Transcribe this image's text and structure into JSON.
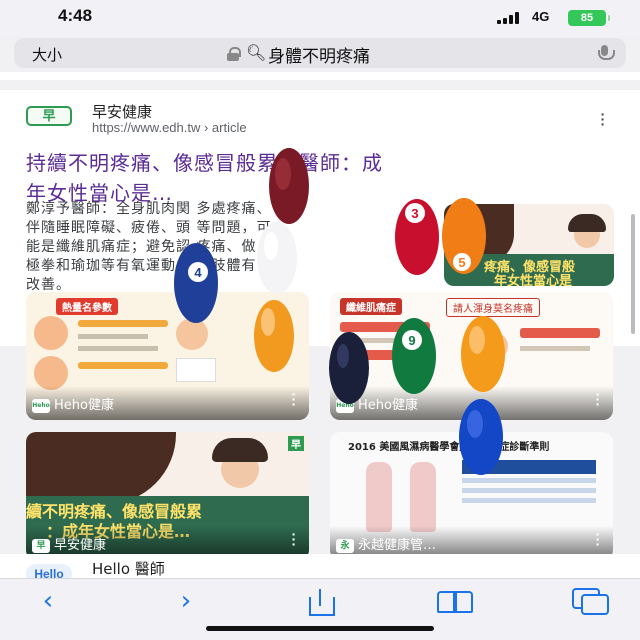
{
  "status_bar": {
    "time": "4:48",
    "network": "4G",
    "battery": "85"
  },
  "address_bar": {
    "text_size_label": "大小",
    "query": "身體不明疼痛"
  },
  "result": {
    "site_name": "早安健康",
    "site_url": "https://www.edh.tw › article",
    "title_line1": "持續不明疼痛、像感冒般累！醫師：成",
    "title_line2": "年女性當心是…",
    "snippet_lines": [
      "鄭淳予醫師：全身肌肉関 多處疼痛、",
      "伴隨睡眠障礙、疲倦、頭 等問題，可",
      "能是纖維肌痛症；避免認 疼痛、做",
      "極拳和瑜珈等有氧運動 伸展肢體有",
      "改善。"
    ],
    "thumbnail_caption_1": "疼痛、像感冒般",
    "thumbnail_caption_2": "年女性當心是"
  },
  "images": [
    {
      "source": "Heho健康",
      "logo": "Heho",
      "banner": "熱量名參數"
    },
    {
      "source": "Heho健康",
      "logo": "Heho",
      "banner": "纖維肌痛症",
      "subtitle": "請人渾身莫名疼痛"
    },
    {
      "source": "早安健康",
      "logo": "早",
      "caption_1": "續不明疼痛、像感冒般累",
      "caption_2": "：成年女性當心是…"
    },
    {
      "source": "永越健康管…",
      "logo": "永",
      "chart_title": "2016 美國風濕病醫學會纖維肌痛症診斷準則"
    }
  ],
  "next_result": {
    "site_name": "Hello 醫師",
    "logo": "Hello"
  },
  "balls": [
    {
      "number": "3",
      "color": "#c8102e"
    },
    {
      "number": "4",
      "color": "#1f3f99"
    },
    {
      "number": "5",
      "color": "#f07d16"
    },
    {
      "number": "9",
      "color": "#107a3f"
    }
  ],
  "colors": {
    "link_title": "#5b2c95",
    "accent": "#1a73e8",
    "battery": "#34c759"
  },
  "icons": [
    "lock-icon",
    "search-icon",
    "mic-icon",
    "back-icon",
    "forward-icon",
    "share-icon",
    "bookmarks-icon",
    "tabs-icon"
  ]
}
